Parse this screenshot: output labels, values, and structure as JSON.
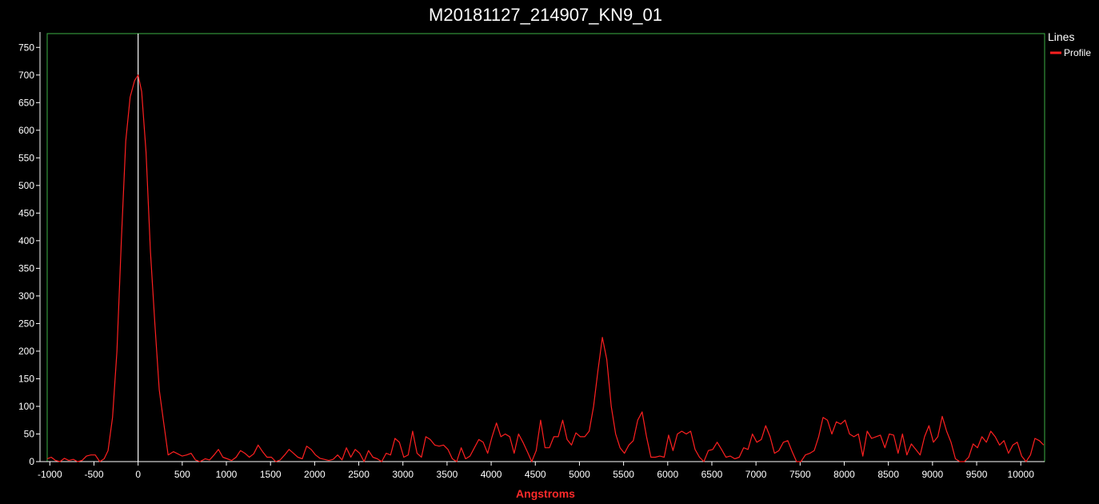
{
  "colors": {
    "background": "#000000",
    "plot_border": "#3cb043",
    "axis": "#ffffff",
    "text": "#ffffff",
    "series": "#ff2020",
    "marker": "#ffffff",
    "xlabel": "#ff2a2a"
  },
  "legend": {
    "title": "Lines",
    "position": "right",
    "items": [
      {
        "label": "Profile",
        "color": "#ff2020"
      }
    ]
  },
  "chart_data": {
    "type": "line",
    "title": "M20181127_214907_KN9_01",
    "xlabel": "Angstroms",
    "ylabel": "",
    "xlim": [
      -1030,
      10270
    ],
    "ylim": [
      0,
      775
    ],
    "grid": false,
    "vertical_marker_x": 0,
    "xticks": [
      -1000,
      -500,
      0,
      500,
      1000,
      1500,
      2000,
      2500,
      3000,
      3500,
      4000,
      4500,
      5000,
      5500,
      6000,
      6500,
      7000,
      7500,
      8000,
      8500,
      9000,
      9500,
      10000
    ],
    "yticks": [
      0,
      50,
      100,
      150,
      200,
      250,
      300,
      350,
      400,
      450,
      500,
      550,
      600,
      650,
      700,
      750
    ],
    "series": [
      {
        "name": "Profile",
        "color": "#ff2020",
        "points": [
          [
            -1030,
            5
          ],
          [
            -985,
            8
          ],
          [
            -935,
            2
          ],
          [
            -885,
            0
          ],
          [
            -835,
            6
          ],
          [
            -785,
            2
          ],
          [
            -735,
            4
          ],
          [
            -685,
            0
          ],
          [
            -635,
            2
          ],
          [
            -585,
            10
          ],
          [
            -535,
            12
          ],
          [
            -485,
            12
          ],
          [
            -435,
            0
          ],
          [
            -385,
            5
          ],
          [
            -340,
            20
          ],
          [
            -290,
            80
          ],
          [
            -240,
            200
          ],
          [
            -190,
            400
          ],
          [
            -140,
            580
          ],
          [
            -90,
            660
          ],
          [
            -40,
            690
          ],
          [
            0,
            700
          ],
          [
            40,
            670
          ],
          [
            90,
            560
          ],
          [
            140,
            380
          ],
          [
            190,
            250
          ],
          [
            240,
            130
          ],
          [
            290,
            70
          ],
          [
            340,
            12
          ],
          [
            400,
            18
          ],
          [
            450,
            14
          ],
          [
            500,
            10
          ],
          [
            550,
            12
          ],
          [
            600,
            15
          ],
          [
            650,
            3
          ],
          [
            700,
            0
          ],
          [
            760,
            5
          ],
          [
            810,
            3
          ],
          [
            860,
            12
          ],
          [
            910,
            22
          ],
          [
            960,
            8
          ],
          [
            1010,
            5
          ],
          [
            1060,
            2
          ],
          [
            1110,
            8
          ],
          [
            1160,
            20
          ],
          [
            1210,
            15
          ],
          [
            1260,
            8
          ],
          [
            1310,
            14
          ],
          [
            1360,
            30
          ],
          [
            1410,
            18
          ],
          [
            1460,
            8
          ],
          [
            1510,
            8
          ],
          [
            1560,
            0
          ],
          [
            1610,
            3
          ],
          [
            1660,
            12
          ],
          [
            1710,
            22
          ],
          [
            1760,
            15
          ],
          [
            1810,
            8
          ],
          [
            1860,
            5
          ],
          [
            1910,
            28
          ],
          [
            1960,
            22
          ],
          [
            2010,
            12
          ],
          [
            2060,
            6
          ],
          [
            2110,
            4
          ],
          [
            2160,
            2
          ],
          [
            2210,
            4
          ],
          [
            2260,
            12
          ],
          [
            2310,
            3
          ],
          [
            2360,
            25
          ],
          [
            2410,
            8
          ],
          [
            2460,
            22
          ],
          [
            2510,
            15
          ],
          [
            2560,
            0
          ],
          [
            2610,
            20
          ],
          [
            2660,
            8
          ],
          [
            2710,
            5
          ],
          [
            2760,
            0
          ],
          [
            2810,
            15
          ],
          [
            2860,
            12
          ],
          [
            2910,
            42
          ],
          [
            2960,
            35
          ],
          [
            3010,
            8
          ],
          [
            3060,
            12
          ],
          [
            3110,
            55
          ],
          [
            3160,
            15
          ],
          [
            3210,
            8
          ],
          [
            3260,
            45
          ],
          [
            3310,
            40
          ],
          [
            3360,
            30
          ],
          [
            3410,
            28
          ],
          [
            3460,
            30
          ],
          [
            3510,
            22
          ],
          [
            3560,
            5
          ],
          [
            3610,
            0
          ],
          [
            3660,
            25
          ],
          [
            3710,
            5
          ],
          [
            3760,
            10
          ],
          [
            3810,
            25
          ],
          [
            3860,
            40
          ],
          [
            3910,
            35
          ],
          [
            3960,
            15
          ],
          [
            4010,
            45
          ],
          [
            4060,
            70
          ],
          [
            4110,
            45
          ],
          [
            4160,
            50
          ],
          [
            4210,
            45
          ],
          [
            4260,
            15
          ],
          [
            4310,
            50
          ],
          [
            4360,
            35
          ],
          [
            4410,
            18
          ],
          [
            4460,
            0
          ],
          [
            4510,
            20
          ],
          [
            4560,
            75
          ],
          [
            4610,
            25
          ],
          [
            4660,
            25
          ],
          [
            4710,
            45
          ],
          [
            4760,
            45
          ],
          [
            4810,
            75
          ],
          [
            4860,
            40
          ],
          [
            4910,
            30
          ],
          [
            4960,
            52
          ],
          [
            5010,
            45
          ],
          [
            5060,
            45
          ],
          [
            5110,
            55
          ],
          [
            5160,
            100
          ],
          [
            5210,
            165
          ],
          [
            5260,
            225
          ],
          [
            5310,
            185
          ],
          [
            5360,
            100
          ],
          [
            5410,
            50
          ],
          [
            5460,
            25
          ],
          [
            5510,
            15
          ],
          [
            5560,
            30
          ],
          [
            5610,
            38
          ],
          [
            5660,
            75
          ],
          [
            5710,
            90
          ],
          [
            5760,
            45
          ],
          [
            5810,
            8
          ],
          [
            5860,
            8
          ],
          [
            5910,
            10
          ],
          [
            5960,
            8
          ],
          [
            6010,
            48
          ],
          [
            6060,
            20
          ],
          [
            6110,
            50
          ],
          [
            6160,
            55
          ],
          [
            6210,
            50
          ],
          [
            6260,
            55
          ],
          [
            6310,
            22
          ],
          [
            6360,
            8
          ],
          [
            6410,
            0
          ],
          [
            6460,
            20
          ],
          [
            6510,
            22
          ],
          [
            6560,
            35
          ],
          [
            6610,
            22
          ],
          [
            6660,
            8
          ],
          [
            6710,
            10
          ],
          [
            6760,
            5
          ],
          [
            6810,
            8
          ],
          [
            6860,
            25
          ],
          [
            6910,
            22
          ],
          [
            6960,
            50
          ],
          [
            7010,
            35
          ],
          [
            7060,
            40
          ],
          [
            7110,
            65
          ],
          [
            7160,
            45
          ],
          [
            7210,
            15
          ],
          [
            7260,
            20
          ],
          [
            7310,
            35
          ],
          [
            7360,
            38
          ],
          [
            7410,
            18
          ],
          [
            7460,
            0
          ],
          [
            7510,
            0
          ],
          [
            7560,
            12
          ],
          [
            7610,
            15
          ],
          [
            7660,
            20
          ],
          [
            7710,
            45
          ],
          [
            7760,
            80
          ],
          [
            7810,
            75
          ],
          [
            7860,
            50
          ],
          [
            7910,
            72
          ],
          [
            7960,
            68
          ],
          [
            8010,
            75
          ],
          [
            8060,
            50
          ],
          [
            8110,
            45
          ],
          [
            8160,
            50
          ],
          [
            8210,
            10
          ],
          [
            8260,
            55
          ],
          [
            8310,
            42
          ],
          [
            8360,
            45
          ],
          [
            8410,
            48
          ],
          [
            8460,
            25
          ],
          [
            8510,
            50
          ],
          [
            8560,
            48
          ],
          [
            8610,
            15
          ],
          [
            8660,
            50
          ],
          [
            8710,
            12
          ],
          [
            8760,
            32
          ],
          [
            8810,
            22
          ],
          [
            8860,
            12
          ],
          [
            8910,
            45
          ],
          [
            8960,
            65
          ],
          [
            9010,
            35
          ],
          [
            9060,
            45
          ],
          [
            9110,
            82
          ],
          [
            9160,
            55
          ],
          [
            9210,
            35
          ],
          [
            9260,
            5
          ],
          [
            9310,
            0
          ],
          [
            9360,
            0
          ],
          [
            9410,
            8
          ],
          [
            9460,
            32
          ],
          [
            9510,
            25
          ],
          [
            9560,
            45
          ],
          [
            9610,
            35
          ],
          [
            9660,
            55
          ],
          [
            9710,
            45
          ],
          [
            9760,
            30
          ],
          [
            9810,
            38
          ],
          [
            9860,
            15
          ],
          [
            9910,
            30
          ],
          [
            9960,
            35
          ],
          [
            10010,
            10
          ],
          [
            10060,
            0
          ],
          [
            10110,
            12
          ],
          [
            10160,
            42
          ],
          [
            10210,
            38
          ],
          [
            10260,
            30
          ]
        ]
      }
    ]
  }
}
